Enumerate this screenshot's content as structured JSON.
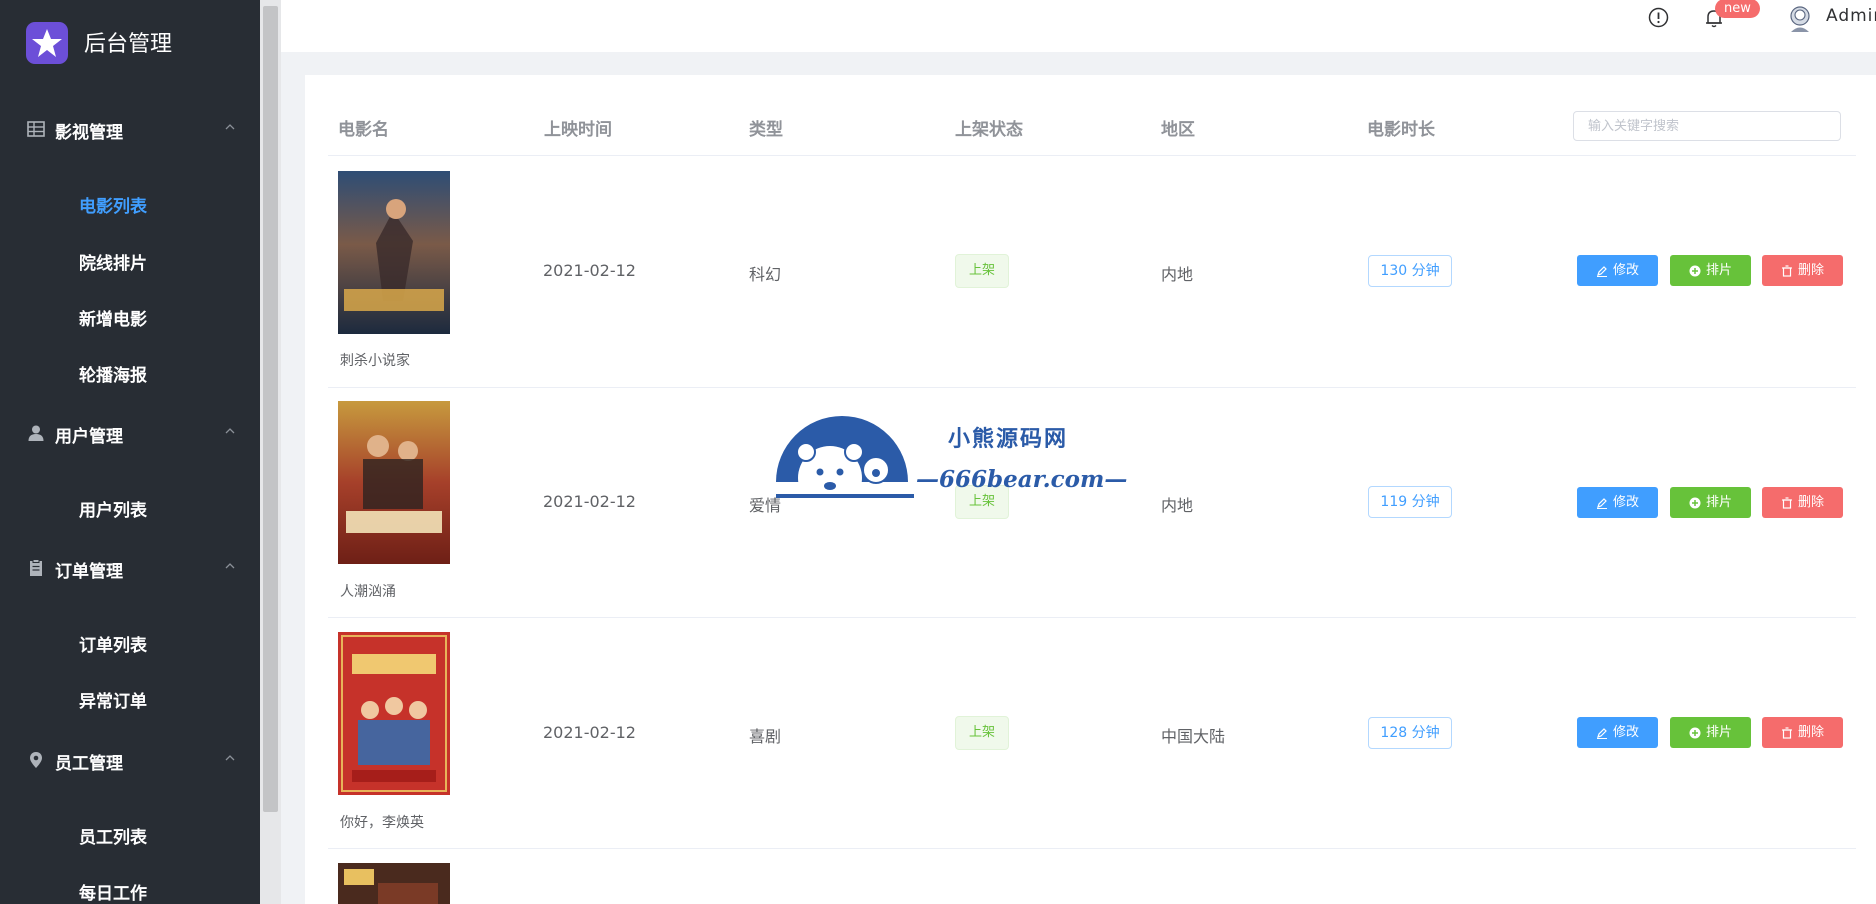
{
  "app": {
    "title": "后台管理"
  },
  "sidebar": {
    "groups": [
      {
        "label": "影视管理",
        "icon": "grid-icon",
        "items": [
          "电影列表",
          "院线排片",
          "新增电影",
          "轮播海报"
        ]
      },
      {
        "label": "用户管理",
        "icon": "user-icon",
        "items": [
          "用户列表"
        ]
      },
      {
        "label": "订单管理",
        "icon": "clipboard-icon",
        "items": [
          "订单列表",
          "异常订单"
        ]
      },
      {
        "label": "员工管理",
        "icon": "map-pin-icon",
        "items": [
          "员工列表",
          "每日工作"
        ]
      }
    ],
    "active_item": "电影列表"
  },
  "header": {
    "new_badge": "new",
    "user_name": "Admin"
  },
  "table": {
    "columns": [
      "电影名",
      "上映时间",
      "类型",
      "上架状态",
      "地区",
      "电影时长"
    ],
    "search_placeholder": "输入关键字搜索",
    "rows": [
      {
        "name": "刺杀小说家",
        "release_date": "2021-02-12",
        "genre": "科幻",
        "status": "上架",
        "region": "内地",
        "duration": "130 分钟"
      },
      {
        "name": "人潮汹涌",
        "release_date": "2021-02-12",
        "genre": "爱情",
        "status": "上架",
        "region": "内地",
        "duration": "119 分钟"
      },
      {
        "name": "你好，李焕英",
        "release_date": "2021-02-12",
        "genre": "喜剧",
        "status": "上架",
        "region": "中国大陆",
        "duration": "128 分钟"
      }
    ],
    "actions": {
      "edit": "修改",
      "schedule": "排片",
      "delete": "删除"
    }
  },
  "watermark": {
    "title": "小熊源码网",
    "url": "—666bear.com—"
  },
  "colors": {
    "sidebar_bg": "#282d34",
    "primary": "#409eff",
    "success": "#67c23a",
    "danger": "#f56c6c"
  }
}
